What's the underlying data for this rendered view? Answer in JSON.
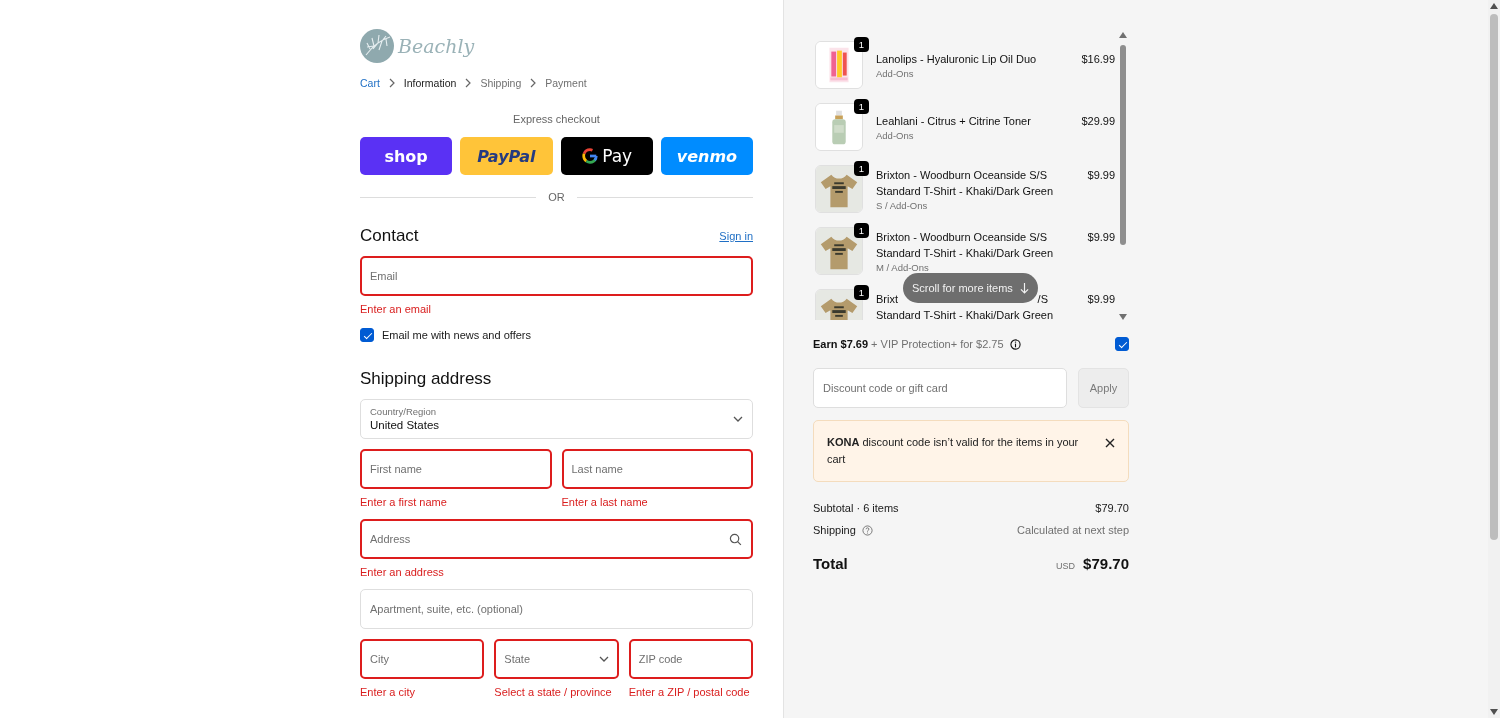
{
  "logo": {
    "text": "Beachly"
  },
  "breadcrumbs": [
    {
      "label": "Cart",
      "kind": "link"
    },
    {
      "label": "Information",
      "kind": "current"
    },
    {
      "label": "Shipping",
      "kind": "upcoming"
    },
    {
      "label": "Payment",
      "kind": "upcoming"
    }
  ],
  "express_checkout": {
    "title": "Express checkout",
    "buttons": [
      {
        "kind": "shop",
        "label": "shop"
      },
      {
        "kind": "paypal",
        "label": "PayPal"
      },
      {
        "kind": "gpay",
        "label": "Pay"
      },
      {
        "kind": "venmo",
        "label": "venmo"
      }
    ]
  },
  "divider_text": "OR",
  "contact": {
    "heading": "Contact",
    "sign_in": "Sign in",
    "email": {
      "placeholder": "Email",
      "invalid": true,
      "error": "Enter an email"
    },
    "newsletter": {
      "label": "Email me with news and offers",
      "checked": true
    }
  },
  "shipping_address": {
    "heading": "Shipping address",
    "rows": [
      {
        "fields": [
          {
            "kind": "select",
            "label": "Country/Region",
            "value": "United States",
            "invalid": false
          }
        ]
      },
      {
        "fields": [
          {
            "kind": "text",
            "placeholder": "First name",
            "invalid": true,
            "error": "Enter a first name"
          },
          {
            "kind": "text",
            "placeholder": "Last name",
            "invalid": true,
            "error": "Enter a last name"
          }
        ]
      },
      {
        "fields": [
          {
            "kind": "search",
            "placeholder": "Address",
            "invalid": true,
            "error": "Enter an address"
          }
        ]
      },
      {
        "fields": [
          {
            "kind": "text",
            "placeholder": "Apartment, suite, etc. (optional)",
            "invalid": false
          }
        ]
      },
      {
        "fields": [
          {
            "kind": "text",
            "placeholder": "City",
            "invalid": true,
            "error": "Enter a city"
          },
          {
            "kind": "select",
            "placeholder": "State",
            "invalid": true,
            "error": "Select a state / province"
          },
          {
            "kind": "text",
            "placeholder": "ZIP code",
            "invalid": true,
            "error": "Enter a ZIP / postal code"
          }
        ]
      }
    ]
  },
  "order_summary": {
    "items": [
      {
        "name": "Lanolips - Hyaluronic Lip Oil Duo",
        "variant": "Add-Ons",
        "price": "$16.99",
        "quantity": "1",
        "image": {
          "kind": "picture"
        }
      },
      {
        "name": "Leahlani - Citrus + Citrine Toner",
        "variant": "Add-Ons",
        "price": "$29.99",
        "quantity": "1",
        "image": {
          "kind": "picture"
        }
      },
      {
        "name": "Brixton - Woodburn Oceanside S/S Standard T-Shirt - Khaki/Dark Green",
        "variant": "S / Add-Ons",
        "price": "$9.99",
        "quantity": "1",
        "image": {
          "kind": "picture"
        }
      },
      {
        "name": "Brixton - Woodburn Oceanside S/S Standard T-Shirt - Khaki/Dark Green",
        "variant": "M / Add-Ons",
        "price": "$9.99",
        "quantity": "1",
        "image": {
          "kind": "picture"
        }
      },
      {
        "name_segments": [
          "Brixt",
          "/S"
        ],
        "name_line_2": "Standard T-Shirt - Khaki/Dark Green",
        "price": "$9.99",
        "quantity": "1",
        "image": {
          "kind": "picture"
        }
      }
    ],
    "scroll_hint": "Scroll for more items",
    "vip": {
      "text": "**Earn $7.69** + VIP Protection+ for $2.75",
      "checked": true
    },
    "discount": {
      "placeholder": "Discount code or gift card",
      "apply": "Apply",
      "disabled": true
    },
    "notice": {
      "text": "**KONA** discount code isn’t valid for the items in your cart"
    },
    "subtotal": {
      "label": "Subtotal · 6 items",
      "value": "$79.70"
    },
    "shipping": {
      "label": "Shipping",
      "value": "Calculated at next step"
    },
    "total": {
      "label": "Total",
      "currency": "USD",
      "value": "$79.70"
    }
  }
}
